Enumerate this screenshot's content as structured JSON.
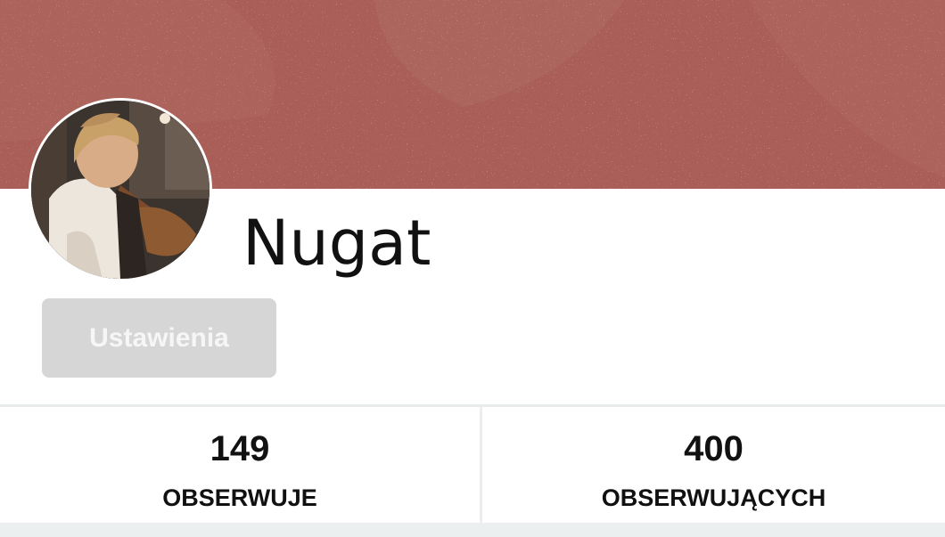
{
  "profile": {
    "username": "Nugat",
    "settings_label": "Ustawienia"
  },
  "stats": [
    {
      "value": "149",
      "label": "OBSERWUJE"
    },
    {
      "value": "400",
      "label": "OBSERWUJĄCYCH"
    }
  ],
  "colors": {
    "cover": "#a95f57",
    "button_bg": "#d6d6d6",
    "text": "#111111"
  }
}
